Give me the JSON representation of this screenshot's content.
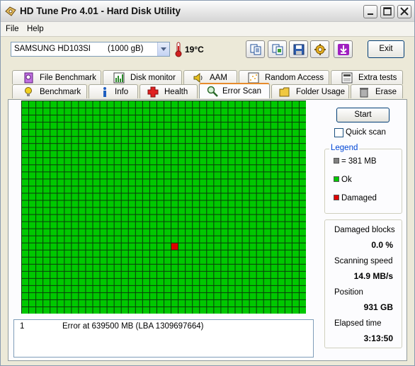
{
  "window": {
    "title": "HD Tune Pro 4.01 - Hard Disk Utility"
  },
  "menu": {
    "file": "File",
    "help": "Help"
  },
  "drive": {
    "name": "SAMSUNG HD103SI",
    "size": "(1000 gB)",
    "temperature": "19°C"
  },
  "toolbar": {
    "buttons": [
      "copy-text-icon",
      "copy-screenshot-icon",
      "save-icon",
      "options-icon",
      "download-icon"
    ],
    "exit_label": "Exit"
  },
  "tabs": {
    "row1": [
      {
        "label": "File Benchmark",
        "icon": "file-benchmark-icon"
      },
      {
        "label": "Disk monitor",
        "icon": "disk-monitor-icon"
      },
      {
        "label": "AAM",
        "icon": "speaker-icon"
      },
      {
        "label": "Random Access",
        "icon": "random-access-icon"
      },
      {
        "label": "Extra tests",
        "icon": "extra-tests-icon"
      }
    ],
    "row2": [
      {
        "label": "Benchmark",
        "icon": "lightbulb-icon"
      },
      {
        "label": "Info",
        "icon": "info-icon"
      },
      {
        "label": "Health",
        "icon": "health-cross-icon"
      },
      {
        "label": "Error Scan",
        "icon": "magnifier-icon",
        "active": true
      },
      {
        "label": "Folder Usage",
        "icon": "folder-icon"
      },
      {
        "label": "Erase",
        "icon": "trash-icon"
      }
    ]
  },
  "scan": {
    "grid_cols": 40,
    "grid_rows": 30,
    "damaged_block": {
      "col": 21,
      "row": 20
    },
    "ok_color": "#00c800",
    "damaged_color": "#e00000",
    "line_color": "#0a3a0a"
  },
  "log": {
    "entries": [
      {
        "num": "1",
        "message": "Error at 639500 MB (LBA 1309697664)"
      }
    ]
  },
  "controls": {
    "start_label": "Start",
    "quick_scan_label": "Quick scan",
    "quick_scan_checked": false
  },
  "legend": {
    "title": "Legend",
    "block_size": "= 381 MB",
    "ok": "Ok",
    "damaged": "Damaged"
  },
  "stats": {
    "damaged_blocks_label": "Damaged blocks",
    "damaged_blocks": "0.0 %",
    "scanning_speed_label": "Scanning speed",
    "scanning_speed": "14.9 MB/s",
    "position_label": "Position",
    "position": "931 GB",
    "elapsed_label": "Elapsed time",
    "elapsed": "3:13:50"
  }
}
